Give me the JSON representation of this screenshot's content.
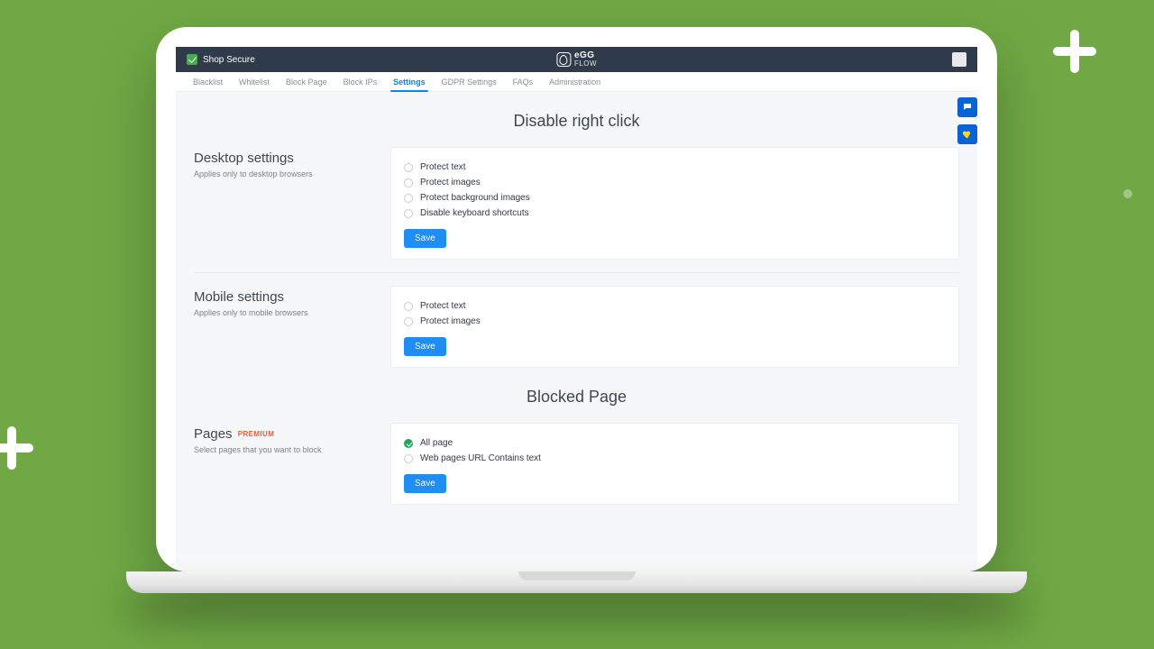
{
  "topbar": {
    "app_name": "Shop Secure",
    "logo_top": "eGG",
    "logo_bottom": "FLOW"
  },
  "tabs": [
    {
      "label": "Blacklist",
      "active": false
    },
    {
      "label": "Whitelist",
      "active": false
    },
    {
      "label": "Block Page",
      "active": false
    },
    {
      "label": "Block IPs",
      "active": false
    },
    {
      "label": "Settings",
      "active": true
    },
    {
      "label": "GDPR Settings",
      "active": false
    },
    {
      "label": "FAQs",
      "active": false
    },
    {
      "label": "Administration",
      "active": false
    }
  ],
  "section1_title": "Disable right click",
  "desktop": {
    "title": "Desktop settings",
    "subtitle": "Applies only to desktop browsers",
    "options": [
      {
        "label": "Protect text",
        "checked": false
      },
      {
        "label": "Protect images",
        "checked": false
      },
      {
        "label": "Protect background images",
        "checked": false
      },
      {
        "label": "Disable keyboard shortcuts",
        "checked": false
      }
    ],
    "save": "Save"
  },
  "mobile": {
    "title": "Mobile settings",
    "subtitle": "Applies only to mobile browsers",
    "options": [
      {
        "label": "Protect text",
        "checked": false
      },
      {
        "label": "Protect images",
        "checked": false
      }
    ],
    "save": "Save"
  },
  "section2_title": "Blocked Page",
  "pages": {
    "title": "Pages",
    "badge": "PREMIUM",
    "subtitle": "Select pages that you want to block",
    "options": [
      {
        "label": "All page",
        "checked": true
      },
      {
        "label": "Web pages URL Contains text",
        "checked": false
      }
    ],
    "save": "Save"
  }
}
